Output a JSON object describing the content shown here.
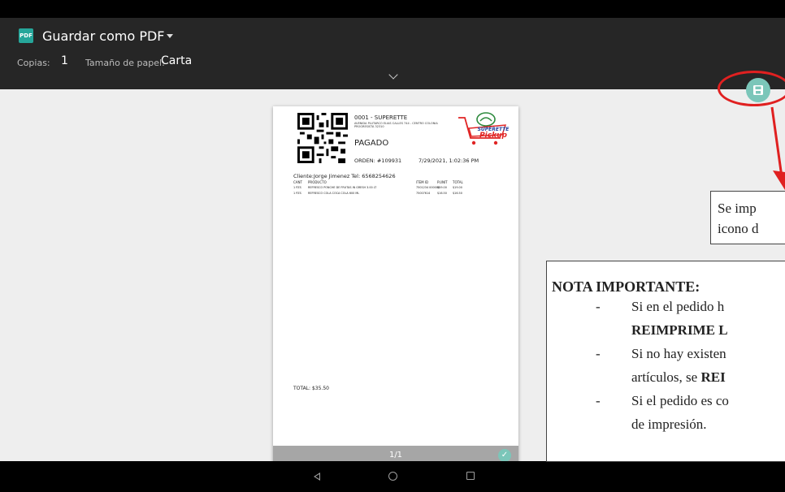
{
  "toolbar": {
    "pdf_badge": "PDF",
    "destination": "Guardar como PDF",
    "copies_label": "Copias:",
    "copies_value": "1",
    "paper_label": "Tamaño de papel:",
    "paper_value": "Carta"
  },
  "receipt": {
    "store": "0001 - SUPERETTE",
    "address": "AVENIDA PLUTARCO ELIAS CALLES 744 - CENTRO COLONIA PROGRESISTA 32310",
    "status": "PAGADO",
    "order": "ORDEN: #109931",
    "datetime": "7/29/2021, 1:02:36 PM",
    "logo_line1": "SUPERETTE",
    "logo_line2": "Pickup",
    "client": "Cliente:Jorge Jimenez Tel: 6568254626",
    "headers": [
      "CANT",
      "PRODUCTO",
      "ITEM ID",
      "P.UNIT",
      "TOTAL"
    ],
    "rows": [
      [
        "1 PZS",
        "REFRESCO PONCHE DE FRUTAS IN GRESH 3.00 LT",
        "7501234 000000",
        "$19.00",
        "$19.00"
      ],
      [
        "1 PZS",
        "REFRESCO COLA COCA COLA 600 ML",
        "75007614",
        "$16.50",
        "$16.50"
      ]
    ],
    "total": "TOTAL: $35.50"
  },
  "page_indicator": "1/1",
  "annotation": {
    "callout_line1": "Se imp",
    "callout_line2": "icono d",
    "note_title": "NOTA IMPORTANTE:",
    "dash": "-",
    "note_lines": [
      {
        "parts": [
          {
            "text": "Si en el pedido h",
            "bold": false
          }
        ]
      },
      {
        "parts": [
          {
            "text": "REIMPRIME L",
            "bold": true
          }
        ]
      },
      {
        "parts": [
          {
            "text": "Si no hay existen",
            "bold": false
          }
        ]
      },
      {
        "parts": [
          {
            "text": "artículos, se ",
            "bold": false
          },
          {
            "text": "REI",
            "bold": true
          }
        ]
      },
      {
        "parts": [
          {
            "text": "Si el pedido es co",
            "bold": false
          }
        ]
      },
      {
        "parts": [
          {
            "text": "de impresión.",
            "bold": false
          }
        ]
      }
    ],
    "color": "#e02020"
  },
  "colors": {
    "accent": "#26a69a",
    "save_button": "#7bc6b9",
    "toolbar_bg": "#262626"
  },
  "icons": {
    "save": "save-pdf-icon",
    "back": "nav-back-icon",
    "home": "nav-home-icon",
    "recents": "nav-recents-icon"
  }
}
